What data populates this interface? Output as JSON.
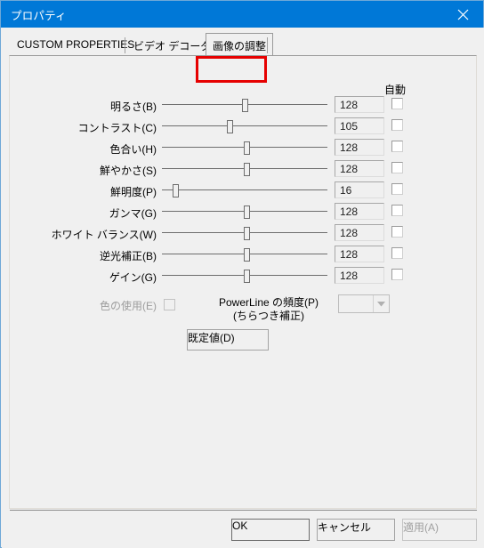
{
  "window": {
    "title": "プロパティ",
    "close_icon": "close-icon",
    "accent_color": "#0078d7",
    "face_color": "#f0f0f0"
  },
  "tabs": [
    {
      "label": "CUSTOM PROPERTIES",
      "selected": false
    },
    {
      "label": "ビデオ デコーダー",
      "selected": false
    },
    {
      "label": "画像の調整",
      "selected": true
    }
  ],
  "annotation": {
    "name": "red-highlight-box",
    "color": "#e60000",
    "targets_tab": "画像の調整"
  },
  "panel": {
    "auto_column_header": "自動",
    "rows": [
      {
        "label": "明るさ(B)",
        "value": "128",
        "slider_percent": 50,
        "auto_checked": false
      },
      {
        "label": "コントラスト(C)",
        "value": "105",
        "slider_percent": 41,
        "auto_checked": false
      },
      {
        "label": "色合い(H)",
        "value": "128",
        "slider_percent": 51,
        "auto_checked": false
      },
      {
        "label": "鮮やかさ(S)",
        "value": "128",
        "slider_percent": 51,
        "auto_checked": false
      },
      {
        "label": "鮮明度(P)",
        "value": "16",
        "slider_percent": 8,
        "auto_checked": false
      },
      {
        "label": "ガンマ(G)",
        "value": "128",
        "slider_percent": 51,
        "auto_checked": false
      },
      {
        "label": "ホワイト バランス(W)",
        "value": "128",
        "slider_percent": 51,
        "auto_checked": false
      },
      {
        "label": "逆光補正(B)",
        "value": "128",
        "slider_percent": 51,
        "auto_checked": false
      },
      {
        "label": "ゲイン(G)",
        "value": "128",
        "slider_percent": 51,
        "auto_checked": false
      }
    ],
    "color_use": {
      "label": "色の使用(E)",
      "checked": false,
      "enabled": false
    },
    "powerline": {
      "label_line1": "PowerLine の頻度(P)",
      "label_line2": "(ちらつき補正)",
      "selected_value": "",
      "enabled": false,
      "arrow_icon": "chevron-down-icon"
    },
    "default_button": "既定値(D)"
  },
  "footer": {
    "ok": "OK",
    "cancel": "キャンセル",
    "apply": "適用(A)",
    "apply_enabled": false
  }
}
